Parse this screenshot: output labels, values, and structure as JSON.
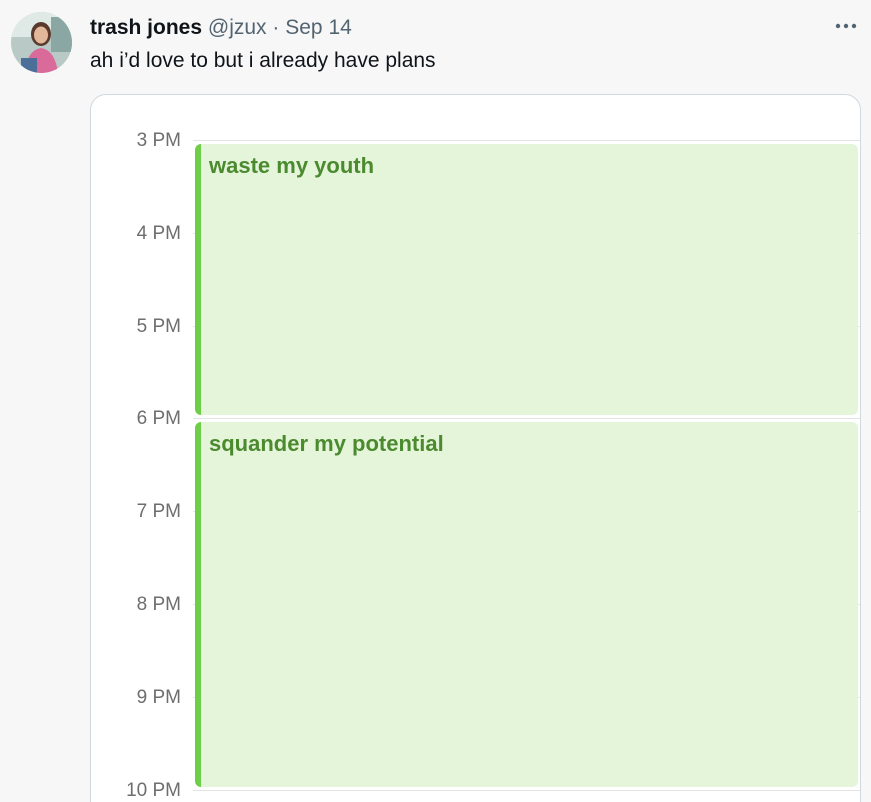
{
  "tweet": {
    "display_name": "trash jones",
    "handle": "@jzux",
    "separator": "·",
    "date": "Sep 14",
    "text": "ah i’d love to but i already have plans"
  },
  "calendar": {
    "hours": [
      "3 PM",
      "4 PM",
      "5 PM",
      "6 PM",
      "7 PM",
      "8 PM",
      "9 PM",
      "10 PM"
    ],
    "events": [
      {
        "title": "waste my youth",
        "start": "3 PM",
        "end": "6 PM"
      },
      {
        "title": "squander my potential",
        "start": "6 PM",
        "end": "10 PM"
      }
    ],
    "event_color": "#6fce47",
    "event_fill": "#e4f5da",
    "event_text_color": "#4b8a2f"
  }
}
